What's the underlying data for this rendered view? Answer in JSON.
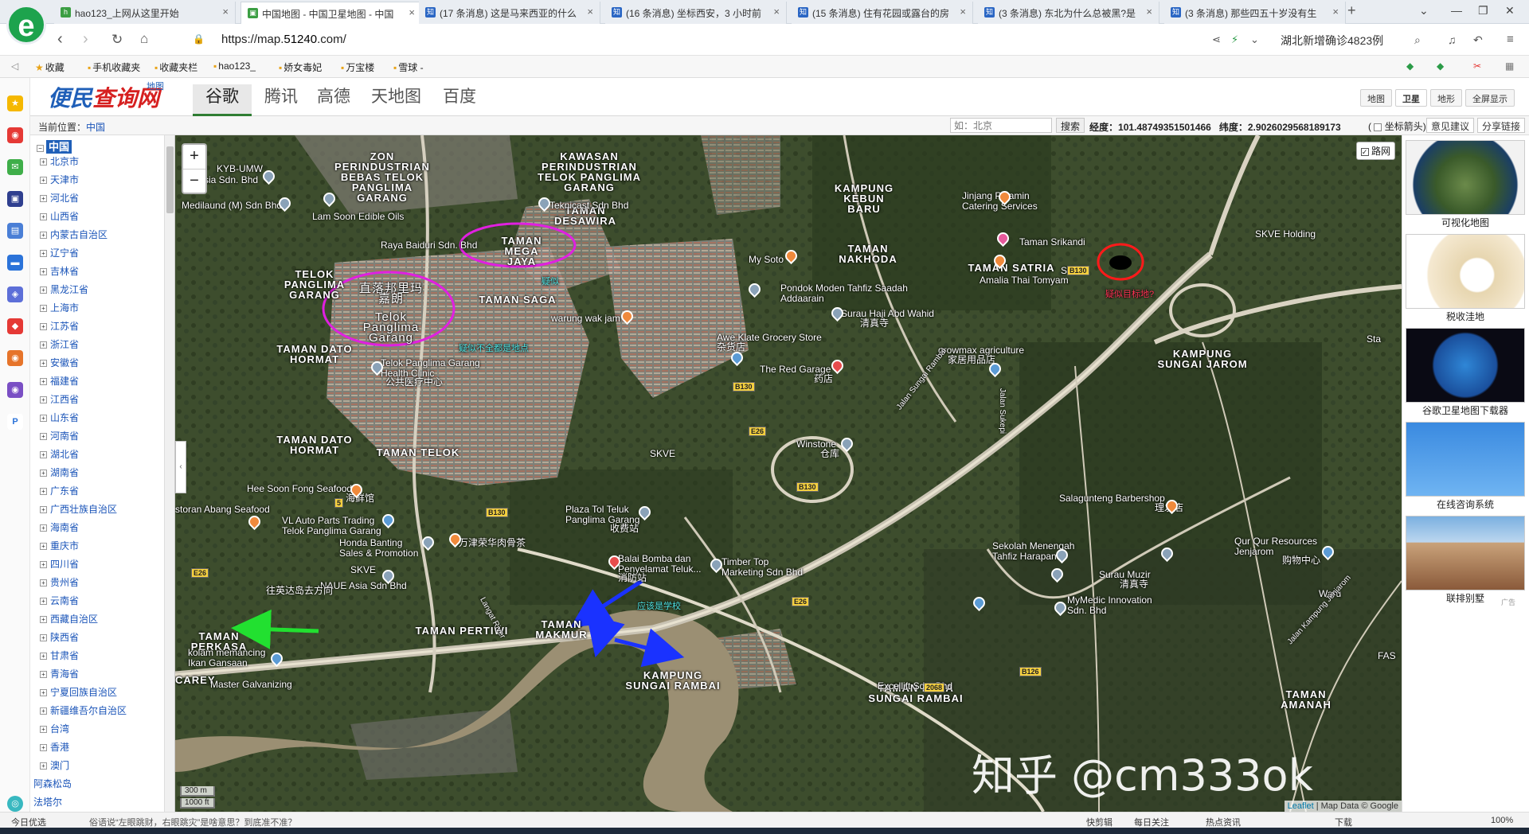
{
  "browser": {
    "logo_glyph": "e",
    "tabs": [
      {
        "title": "hao123_上网从这里开始",
        "icon": "hao123-icon"
      },
      {
        "title": "中国地图 - 中国卫星地图 - 中国",
        "icon": "map-icon"
      },
      {
        "title": "(17 条消息) 这是马来西亚的什么",
        "icon": "zhihu-icon"
      },
      {
        "title": "(16 条消息) 坐标西安，3 小时前",
        "icon": "zhihu-icon"
      },
      {
        "title": "(15 条消息) 住有花园或露台的房",
        "icon": "zhihu-icon"
      },
      {
        "title": "(3 条消息) 东北为什么总被黑?是",
        "icon": "zhihu-icon"
      },
      {
        "title": "(3 条消息) 那些四五十岁没有生",
        "icon": "zhihu-icon"
      }
    ],
    "active_tab": 1,
    "new_tab_glyph": "+",
    "url_scheme": "https://map.",
    "url_domain": "51240",
    "url_rest": ".com/",
    "news_ticker": "湖北新增确诊4823例",
    "bookmarks": [
      "收藏",
      "手机收藏夹",
      "收藏夹栏",
      "hao123_",
      "娇女毒妃",
      "万宝楼",
      "雪球 -"
    ]
  },
  "site": {
    "brand_main": "便民",
    "brand_accent": "查询网",
    "brand_sub": "地图",
    "provider_tabs": [
      "谷歌",
      "腾讯",
      "高德",
      "天地图",
      "百度"
    ],
    "active_provider": "谷歌",
    "map_type_buttons": [
      "地图",
      "卫星",
      "地形",
      "全屏显示"
    ],
    "active_map_type": "卫星",
    "location_label": "当前位置：",
    "location_value": "中国",
    "search_placeholder": "如：北京",
    "search_button": "搜索",
    "longitude_label": "经度：",
    "longitude": "101.48749351501466",
    "latitude_label": "纬度：",
    "latitude": "2.9026029568189173",
    "arrow_checkbox_label": "坐标箭头",
    "feedback_button": "意见建议",
    "share_button": "分享链接"
  },
  "tree": {
    "root": "中国",
    "provinces": [
      "北京市",
      "天津市",
      "河北省",
      "山西省",
      "内蒙古自治区",
      "辽宁省",
      "吉林省",
      "黑龙江省",
      "上海市",
      "江苏省",
      "浙江省",
      "安徽省",
      "福建省",
      "江西省",
      "山东省",
      "河南省",
      "湖北省",
      "湖南省",
      "广东省",
      "广西壮族自治区",
      "海南省",
      "重庆市",
      "四川省",
      "贵州省",
      "云南省",
      "西藏自治区",
      "陕西省",
      "甘肃省",
      "青海省",
      "宁夏回族自治区",
      "新疆维吾尔自治区",
      "台湾",
      "香港",
      "澳门"
    ],
    "extra": [
      "阿森松岛",
      "法塔尔"
    ]
  },
  "map": {
    "zoom_in": "+",
    "zoom_out": "−",
    "roadnet_label": "路网",
    "scale_m": "300 m",
    "scale_ft": "1000 ft",
    "attribution_link": "Leaflet",
    "attribution_text": "| Map Data © Google",
    "watermark": "知乎 @cm333ok",
    "labels": {
      "zon_perindustrian": "ZON PERINDUSTRIAN BEBAS TELOK PANGLIMA GARANG",
      "kawasan_perindustrian": "KAWASAN PERINDUSTRIAN TELOK PANGLIMA GARANG",
      "taman_desawira": "TAMAN DESAWIRA",
      "kampung_kebun_baru": "KAMPUNG KEBUN BARU",
      "taman_mega_jaya": "TAMAN MEGA JAYA",
      "telok_panglima_garang": "TELOK PANGLIMA GARANG",
      "chinese_name_circle": "直落邦里玛嘉朗",
      "telok_circle": "Telok Panglima Garang",
      "taman_saga": "TAMAN SAGA",
      "taman_nakhoda": "TAMAN NAKHODA",
      "taman_satria": "TAMAN SATRIA",
      "taman_dato_hormat_1": "TAMAN DATO HORMAT",
      "taman_dato_hormat_2": "TAMAN DATO HORMAT",
      "taman_telok": "TAMAN TELOK",
      "kampung_sungai_jarom": "KAMPUNG SUNGAI JAROM",
      "taman_perkasa": "TAMAN PERKASA",
      "taman_pertiwi": "TAMAN PERTIWI",
      "taman_makmur": "TAMAN MAKMUR",
      "kampung_sungai_rambai": "KAMPUNG SUNGAI RAMBAI",
      "taman_kota_sungai_rambai": "TAMAN KOTA SUNGAI RAMBAI",
      "carey": "CAREY",
      "taman_amanah": "TAMAN AMANAH",
      "kyb_umw": "KYB-UMW",
      "kyb_umw_2": "ysia Sdn. Bhd",
      "medilaund": "Medilaund (M) Sdn Bhd",
      "lam_soon": "Lam Soon Edible Oils",
      "teknicast": "Teknicast Sdn Bhd",
      "raya_baiduri": "Raya Baiduri Sdn. Bhd",
      "jinjang": "Jinjang Pelamin Catering Services",
      "taman_srikandi": "Taman Srikandi",
      "my_soto": "My Soto",
      "amalia": "Amalia Thai Tomyam",
      "skve_holding": "SKVE Holding",
      "pondok": "Pondok Moden Tahfiz Saadah Addaarain",
      "surau_haji": "Surau Haji Abd Wahid",
      "surau_haji_cn": "清真寺",
      "warung": "warung wak jam",
      "awe_klate": "Awe Klate Grocery Store",
      "awe_klate_cn": "杂货店",
      "growmax": "growmax agriculture",
      "growmax_cn": "家居用品店",
      "red_garage": "The Red Garage",
      "red_garage_cn": "药店",
      "telok_clinic": "Telok Panglima Garang Health Clinic",
      "telok_clinic_cn": "公共医疗中心",
      "jalan_sungai_rambai": "Jalan Sungai Rambai",
      "jalan_sukepi": "Jalan Sukepi",
      "winstone": "Winstone",
      "winstone_cn": "仓库",
      "hee_soon": "Hee Soon Fong Seafood",
      "hee_soon_cn": "海鲜馆",
      "abang_seafood": "storan Abang Seafood",
      "vl_auto": "VL Auto Parts Trading Telok Panglima Garang",
      "honda": "Honda Banting Sales & Promotion",
      "wanjin": "万津荣华肉骨茶",
      "plaza_tol": "Plaza Tol Teluk Panglima Garang",
      "plaza_tol_cn": "收费站",
      "balai_bomba": "Balai Bomba dan Penyelamat Teluk...",
      "balai_bomba_cn": "消防站",
      "timber_top": "Timber Top Marketing Sdn Bhd",
      "salagunteng": "Salagunteng Barbershop",
      "salagunteng_cn": "理发店",
      "qur_qur": "Qur Qur Resources Jenjarom",
      "qur_qur_cn": "购物中心",
      "sekolah": "Sekolah Menengah Tahfiz Harapan",
      "surau_muzir": "Surau Muzir",
      "surau_muzir_cn": "清真寺",
      "mymedic": "MyMedic Innovation Sdn. Bhd",
      "naue": "NAUE Asia Sdn Bhd",
      "kolam": "kolam memancing Ikan Gansaan",
      "master_galvanizing": "Master Galvanizing",
      "excellift": "Excellift Sdn. Bhd",
      "jalan_kampung_jenjarom": "Jalan Kampung Jenjarom",
      "langat_river": "Langat River",
      "waru": "Waru",
      "fas": "FAS",
      "sta": "Sta",
      "skve_1": "SKVE",
      "skve_2": "SKVE",
      "skve_3": "SKVE",
      "ann_not_all": "疑似不全都是地点",
      "ann_mega": "疑似",
      "ann_target": "疑似目标地?",
      "ann_direction": "往英达岛去方向",
      "ann_school": "应该是学校"
    },
    "road_shields": [
      "E26",
      "B130",
      "E26",
      "B130",
      "B130",
      "E26",
      "B130",
      "2068",
      "B126",
      "5"
    ]
  },
  "right_panel": [
    {
      "caption": "可视化地图",
      "icon": "globe-asia-icon"
    },
    {
      "caption": "税收洼地",
      "icon": "china-map-icon"
    },
    {
      "caption": "谷歌卫星地图下载器",
      "icon": "earth-icon"
    },
    {
      "caption": "在线咨询系统",
      "icon": "person-icon"
    },
    {
      "caption": "联排别墅",
      "icon": "villa-icon"
    }
  ],
  "ad_label": "广告",
  "status": {
    "left": "今日优选",
    "headline": "俗语说“左眼跳财，右眼跳灾”是啥意思？到底准不准？",
    "items": [
      "快剪辑",
      "每日关注",
      "热点资讯",
      "下载",
      "100%"
    ]
  },
  "colors": {
    "annotation_magenta": "#e020e0",
    "annotation_red": "#ff1a1a",
    "arrow_green": "#22e030",
    "arrow_blue": "#1a32ff",
    "brand_red": "#d62020",
    "brand_blue": "#1f5fb8"
  }
}
